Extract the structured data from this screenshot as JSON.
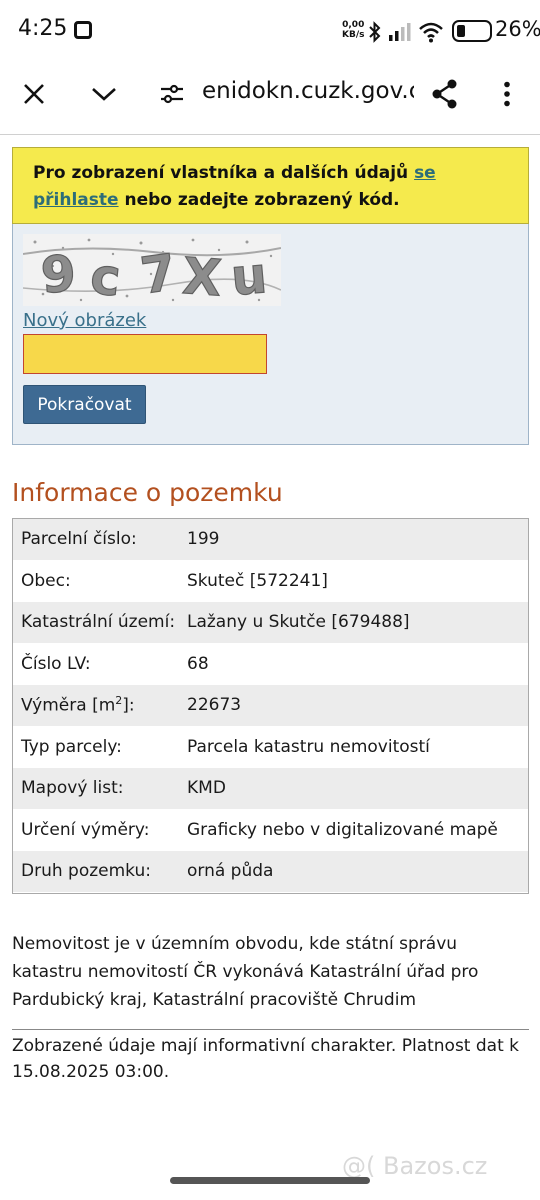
{
  "status_bar": {
    "time": "4:25",
    "speed_value": "0,00",
    "speed_unit": "KB/s",
    "battery": "26%",
    "icons": [
      "bluetooth-icon",
      "signal-icon",
      "wifi-icon",
      "battery-icon"
    ]
  },
  "browser": {
    "url": "enidokn.cuzk.gov.cz",
    "icons": [
      "close-icon",
      "chevron-down-icon",
      "site-settings-icon",
      "share-icon",
      "more-icon"
    ]
  },
  "notice": {
    "text_before": "Pro zobrazení vlastníka a dalších údajů ",
    "link": "se přihlaste",
    "text_after": " nebo zadejte zobrazený kód."
  },
  "captcha": {
    "image_text": "9c7Xu",
    "new_image_link": "Nový obrázek",
    "input_value": "",
    "continue_button": "Pokračovat"
  },
  "section_title": "Informace o pozemku",
  "info_rows": [
    {
      "label": "Parcelní číslo:",
      "value": "199"
    },
    {
      "label": "Obec:",
      "value": "Skuteč [572241]"
    },
    {
      "label": "Katastrální území:",
      "value": "Lažany u Skutče [679488]"
    },
    {
      "label": "Číslo LV:",
      "value": "68"
    },
    {
      "label_prefix": "Výměra [m",
      "label_sup": "2",
      "label_suffix": "]:",
      "value": "22673"
    },
    {
      "label": "Typ parcely:",
      "value": "Parcela katastru nemovitostí"
    },
    {
      "label": "Mapový list:",
      "value": "KMD"
    },
    {
      "label": "Určení výměry:",
      "value": "Graficky nebo v digitalizované mapě"
    },
    {
      "label": "Druh pozemku:",
      "value": "orná půda"
    }
  ],
  "office_text": "Nemovitost je v územním obvodu, kde státní správu katastru nemovitostí ČR vykonává Katastrální úřad pro Pardubický kraj, Katastrální pracoviště Chrudim",
  "disclaimer": "Zobrazené údaje mají informativní charakter. Platnost dat k 15.08.2025 03:00.",
  "watermark": "@( Bazos.cz"
}
